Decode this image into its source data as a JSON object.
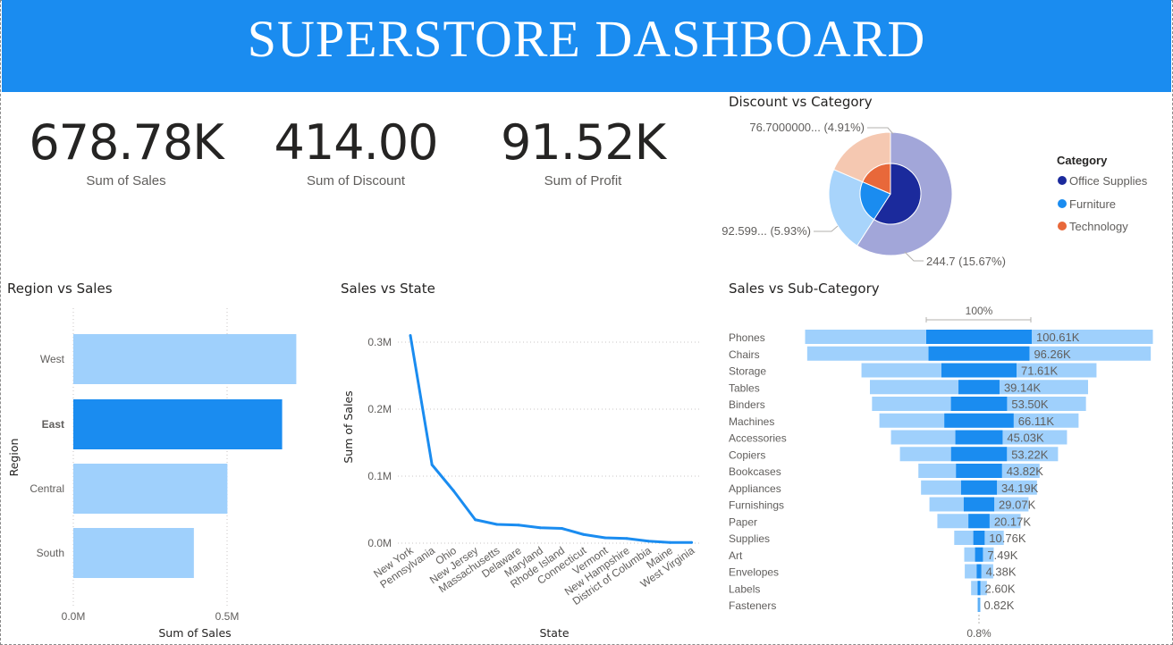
{
  "header": {
    "title": "SUPERSTORE DASHBOARD"
  },
  "kpis": [
    {
      "value": "678.78K",
      "label": "Sum of Sales"
    },
    {
      "value": "414.00",
      "label": "Sum of Discount"
    },
    {
      "value": "91.52K",
      "label": "Sum of Profit"
    }
  ],
  "colors": {
    "banner": "#1a8cf0",
    "light_bar": "#9fd0fc",
    "dark_bar": "#1a8cf0",
    "office": "#1b2a9c",
    "furniture": "#1a8cf0",
    "technology": "#e8683a"
  },
  "donut": {
    "title": "Discount vs Category",
    "legend_title": "Category",
    "legend": [
      "Office Supplies",
      "Furniture",
      "Technology"
    ],
    "label_office": "244.7 (15.67%)",
    "label_furniture": "92.599... (5.93%)",
    "label_technology": "76.7000000... (4.91%)"
  },
  "region": {
    "title": "Region vs Sales",
    "xlabel": "Sum of Sales",
    "ylabel": "Region",
    "xticks": [
      "0.0M",
      "0.5M"
    ]
  },
  "state": {
    "title": "Sales vs State",
    "xlabel": "State",
    "ylabel": "Sum of Sales",
    "yticks": [
      "0.0M",
      "0.1M",
      "0.2M",
      "0.3M"
    ]
  },
  "subcat": {
    "title": "Sales vs Sub-Category",
    "top_label": "100%",
    "bottom_label": "0.8%"
  },
  "chart_data": [
    {
      "type": "bar",
      "title": "Region vs Sales",
      "orientation": "horizontal",
      "categories": [
        "West",
        "East",
        "Central",
        "South"
      ],
      "values": [
        725000,
        679000,
        501000,
        392000
      ],
      "highlighted": "East",
      "xlabel": "Sum of Sales",
      "ylabel": "Region",
      "xlim": [
        0,
        0.75
      ]
    },
    {
      "type": "line",
      "title": "Sales vs State",
      "x": [
        "New York",
        "Pennsylvania",
        "Ohio",
        "New Jersey",
        "Massachusetts",
        "Delaware",
        "Maryland",
        "Rhode Island",
        "Connecticut",
        "Vermont",
        "New Hampshire",
        "District of Columbia",
        "Maine",
        "West Virginia"
      ],
      "values": [
        310000,
        117000,
        78000,
        35000,
        28000,
        27000,
        23000,
        22000,
        13000,
        8000,
        7000,
        3000,
        1000,
        1000
      ],
      "xlabel": "State",
      "ylabel": "Sum of Sales",
      "ylim": [
        0,
        0.31
      ]
    },
    {
      "type": "bar",
      "title": "Sales vs Sub-Category",
      "subtype": "funnel",
      "categories": [
        "Phones",
        "Chairs",
        "Storage",
        "Tables",
        "Binders",
        "Machines",
        "Accessories",
        "Copiers",
        "Bookcases",
        "Appliances",
        "Furnishings",
        "Paper",
        "Supplies",
        "Art",
        "Envelopes",
        "Labels",
        "Fasteners"
      ],
      "labels": [
        "100.61K",
        "96.26K",
        "71.61K",
        "39.14K",
        "53.50K",
        "66.11K",
        "45.03K",
        "53.22K",
        "43.82K",
        "34.19K",
        "29.07K",
        "20.17K",
        "10.76K",
        "7.49K",
        "4.38K",
        "2.60K",
        "0.82K"
      ],
      "values": [
        100.61,
        96.26,
        71.61,
        39.14,
        53.5,
        66.11,
        45.03,
        53.22,
        43.82,
        34.19,
        29.07,
        20.17,
        10.76,
        7.49,
        4.38,
        2.6,
        0.82
      ],
      "background_values": [
        330,
        326,
        223,
        207,
        203,
        189,
        167,
        150,
        115,
        110,
        94,
        79,
        47,
        28,
        27,
        15,
        3
      ]
    },
    {
      "type": "pie",
      "title": "Discount vs Category",
      "subtype": "nested-donut",
      "categories": [
        "Office Supplies",
        "Furniture",
        "Technology"
      ],
      "values": [
        244.7,
        92.599,
        76.7
      ],
      "percent_labels": [
        "15.67%",
        "5.93%",
        "4.91%"
      ]
    }
  ]
}
